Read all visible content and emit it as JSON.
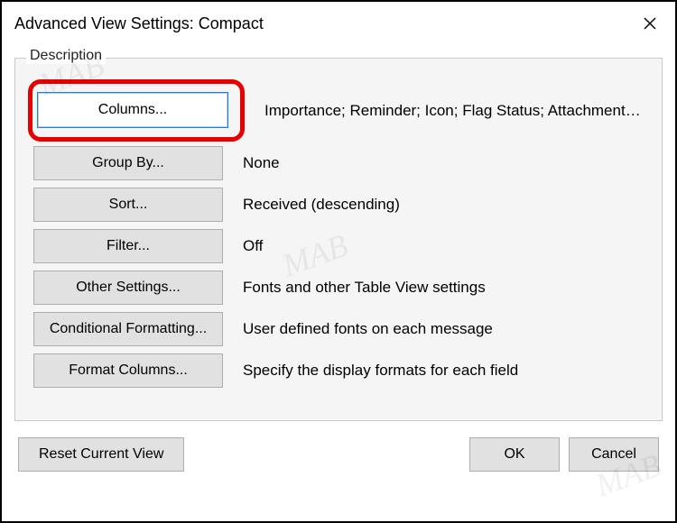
{
  "title": "Advanced View Settings: Compact",
  "group_label": "Description",
  "rows": [
    {
      "button": "Columns...",
      "summary": "Importance; Reminder; Icon; Flag Status; Attachment; From..."
    },
    {
      "button": "Group By...",
      "summary": "None"
    },
    {
      "button": "Sort...",
      "summary": "Received (descending)"
    },
    {
      "button": "Filter...",
      "summary": "Off"
    },
    {
      "button": "Other Settings...",
      "summary": "Fonts and other Table View settings"
    },
    {
      "button": "Conditional Formatting...",
      "summary": "User defined fonts on each message"
    },
    {
      "button": "Format Columns...",
      "summary": "Specify the display formats for each field"
    }
  ],
  "reset_label": "Reset Current View",
  "ok_label": "OK",
  "cancel_label": "Cancel",
  "watermark": "MAB"
}
